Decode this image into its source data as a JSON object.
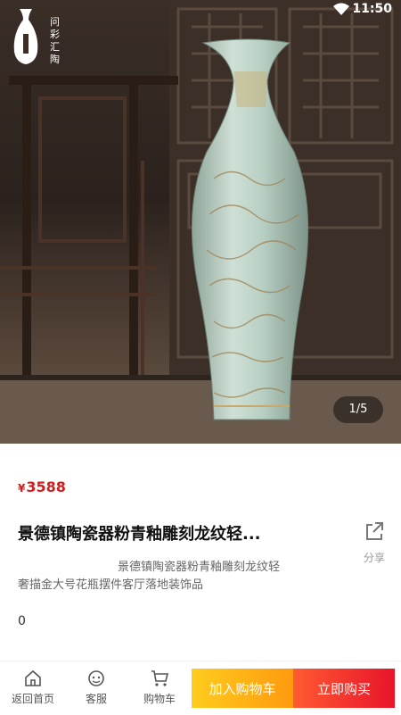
{
  "status": {
    "time": "11:50"
  },
  "brand": {
    "logo_text": "问彩汇陶"
  },
  "gallery": {
    "indicator": "1/5"
  },
  "product": {
    "currency": "¥",
    "price": "3588",
    "title": "景德镇陶瓷器粉青釉雕刻龙纹轻...",
    "description": "景德镇陶瓷器粉青釉雕刻龙纹轻奢描金大号花瓶摆件客厅落地装饰品",
    "sales": "0"
  },
  "share": {
    "label": "分享"
  },
  "bottom_bar": {
    "home_label": "返回首页",
    "service_label": "客服",
    "cart_label": "购物车",
    "add_to_cart_label": "加入购物车",
    "buy_now_label": "立即购买"
  },
  "colors": {
    "price": "#d11e1e",
    "cart_button": "#ffb31a",
    "buy_button": "#ec2a2a"
  }
}
